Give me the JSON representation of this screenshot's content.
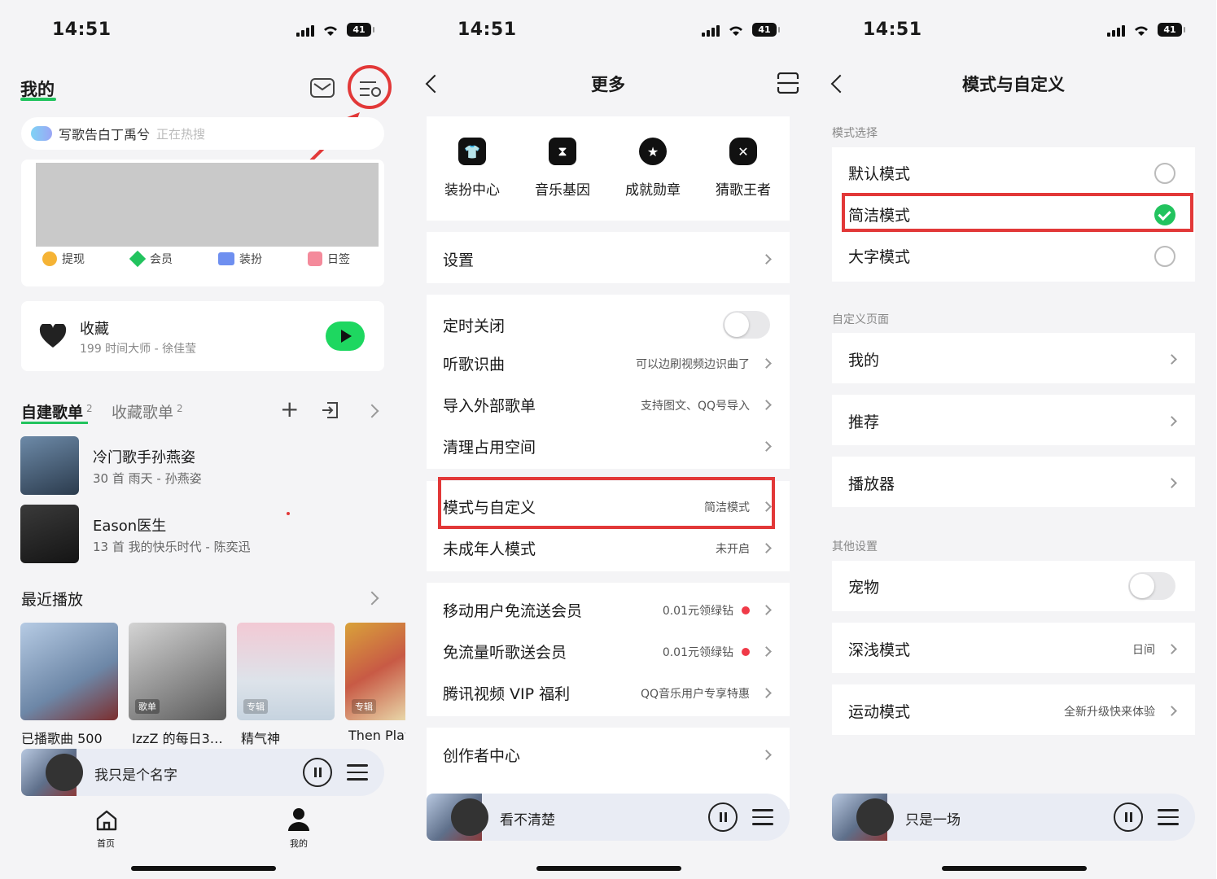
{
  "status": {
    "time": "14:51",
    "battery": "41"
  },
  "screen1": {
    "page_title": "我的",
    "search_text": "写歌告白丁禹兮",
    "search_tag": "正在热搜",
    "quick": [
      "提现",
      "会员",
      "装扮",
      "日签"
    ],
    "fav_title": "收藏",
    "fav_sub": "199  时间大师 - 徐佳莹",
    "tab_created": "自建歌单",
    "tab_created_count": "2",
    "tab_collected": "收藏歌单",
    "tab_collected_count": "2",
    "playlists": [
      {
        "title": "冷门歌手孙燕姿",
        "sub": "30 首  雨天 - 孙燕姿"
      },
      {
        "title": "Eason医生",
        "sub": "13 首  我的快乐时代 - 陈奕迅"
      }
    ],
    "recent_title": "最近播放",
    "recent": [
      {
        "label": "已播歌曲 500",
        "tag": ""
      },
      {
        "label": "IzzZ 的每日3…",
        "tag": "歌单"
      },
      {
        "label": "精气神",
        "tag": "专辑"
      },
      {
        "label": "Then Play",
        "tag": "专辑"
      }
    ],
    "player_title": "我只是个名字",
    "tab_home": "首页",
    "tab_mine": "我的"
  },
  "screen2": {
    "title": "更多",
    "grid": [
      "装扮中心",
      "音乐基因",
      "成就勋章",
      "猜歌王者"
    ],
    "settings": "设置",
    "timer": "定时关闭",
    "recognize": "听歌识曲",
    "recognize_hint": "可以边刷视频边识曲了",
    "import": "导入外部歌单",
    "import_hint": "支持图文、QQ号导入",
    "clean": "清理占用空间",
    "mode": "模式与自定义",
    "mode_value": "简洁模式",
    "minor": "未成年人模式",
    "minor_value": "未开启",
    "mobile": "移动用户免流送会员",
    "mobile_hint": "0.01元领绿钻",
    "freeflow": "免流量听歌送会员",
    "freeflow_hint": "0.01元领绿钻",
    "tencent": "腾讯视频 VIP 福利",
    "tencent_hint": "QQ音乐用户专享特惠",
    "creator": "创作者中心",
    "player_title": "看不清楚"
  },
  "screen3": {
    "title": "模式与自定义",
    "sec_mode": "模式选择",
    "modes": [
      "默认模式",
      "简洁模式",
      "大字模式"
    ],
    "sec_custom": "自定义页面",
    "custom": [
      "我的",
      "推荐",
      "播放器"
    ],
    "sec_other": "其他设置",
    "pet": "宠物",
    "theme": "深浅模式",
    "theme_value": "日间",
    "sport": "运动模式",
    "sport_value": "全新升级快来体验",
    "player_title": "只是一场"
  },
  "colors": {
    "accent": "#22c35e",
    "highlight": "#e23838"
  }
}
